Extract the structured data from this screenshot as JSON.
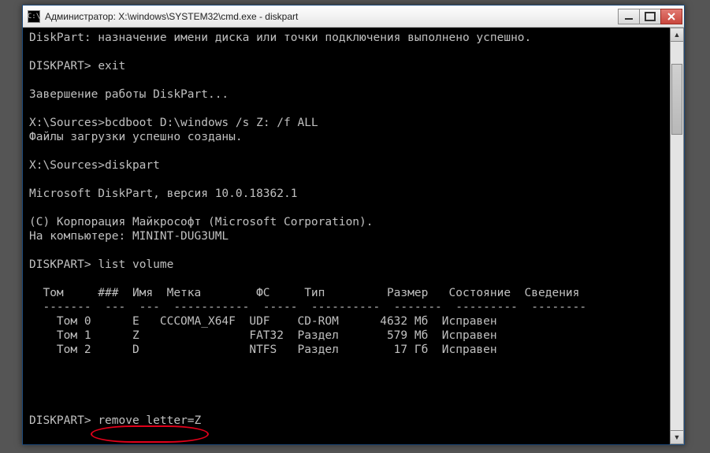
{
  "window": {
    "title": "Администратор: X:\\windows\\SYSTEM32\\cmd.exe - diskpart"
  },
  "terminal": {
    "line01": "DiskPart: назначение имени диска или точки подключения выполнено успешно.",
    "line02": "",
    "line03_prompt": "DISKPART> ",
    "line03_cmd": "exit",
    "line04": "",
    "line05": "Завершение работы DiskPart...",
    "line06": "",
    "line07_prompt": "X:\\Sources>",
    "line07_cmd": "bcdboot D:\\windows /s Z: /f ALL",
    "line08": "Файлы загрузки успешно созданы.",
    "line09": "",
    "line10_prompt": "X:\\Sources>",
    "line10_cmd": "diskpart",
    "line11": "",
    "line12": "Microsoft DiskPart, версия 10.0.18362.1",
    "line13": "",
    "line14": "(C) Корпорация Майкрософт (Microsoft Corporation).",
    "line15": "На компьютере: MININT-DUG3UML",
    "line16": "",
    "line17_prompt": "DISKPART> ",
    "line17_cmd": "list volume",
    "line18": "",
    "table_header": "  Том     ###  Имя  Метка        ФС     Тип         Размер   Состояние  Сведения",
    "table_divider": "  -------  ---  ---  -----------  -----  ----------  -------  ---------  --------",
    "table_rows": [
      "    Том 0      E   CCCOMA_X64F  UDF    CD-ROM      4632 Мб  Исправен",
      "    Том 1      Z                FAT32  Раздел       579 Мб  Исправен",
      "    Том 2      D                NTFS   Раздел        17 Гб  Исправен"
    ],
    "last_prompt": "DISKPART> ",
    "last_cmd": "remove letter=Z"
  },
  "scrollbar": {
    "up": "▲",
    "down": "▼"
  }
}
